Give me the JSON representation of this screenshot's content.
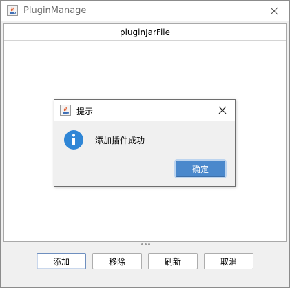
{
  "window": {
    "title": "PluginManage"
  },
  "table": {
    "columns": [
      "pluginJarFile"
    ]
  },
  "buttons": {
    "add": "添加",
    "remove": "移除",
    "refresh": "刷新",
    "cancel": "取消"
  },
  "dialog": {
    "title": "提示",
    "message": "添加插件成功",
    "ok_label": "确定"
  },
  "icons": {
    "window": "java-cup-icon",
    "close": "close-icon",
    "info": "info-icon"
  },
  "colors": {
    "accent": "#4a88cc",
    "info_icon": "#2f86d6"
  }
}
